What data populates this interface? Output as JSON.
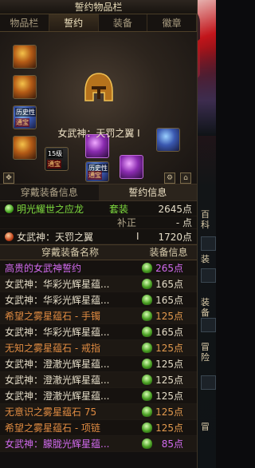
{
  "window": {
    "title": "誓约物品栏"
  },
  "tabs": [
    {
      "label": "物品栏",
      "active": false
    },
    {
      "label": "誓约",
      "active": true
    },
    {
      "label": "装备",
      "active": false
    },
    {
      "label": "徽章",
      "active": false
    }
  ],
  "equip": {
    "title": "女武神：天罚之翼 I",
    "tags": {
      "slot_a": "历史性",
      "slot_a2": "通宝",
      "slot_b": "15级",
      "slot_b2": "通宝",
      "slot_c": "历史性",
      "slot_c2": "通宝"
    }
  },
  "subtabs": [
    {
      "label": "穿戴装备信息",
      "active": false
    },
    {
      "label": "誓约信息",
      "active": true
    }
  ],
  "set_info": {
    "set_name": "明光耀世之应龙",
    "set_type": "套装",
    "set_points": "2645点",
    "bonus_label": "补正",
    "bonus_value": "- 点",
    "item_name": "女武神：天罚之翼",
    "item_level": "I",
    "item_points": "1720点"
  },
  "list": {
    "col_name": "穿戴装备名称",
    "col_info": "装备信息",
    "rows": [
      {
        "name": "高贵的女武神誓约",
        "points": "265点",
        "color": "purple"
      },
      {
        "name": "女武神：华彩光辉星蕴...",
        "points": "165点",
        "color": "white"
      },
      {
        "name": "女武神：华彩光辉星蕴...",
        "points": "165点",
        "color": "white"
      },
      {
        "name": "希望之雾星蕴石 - 手镯",
        "points": "125点",
        "color": "orange"
      },
      {
        "name": "女武神：华彩光辉星蕴...",
        "points": "165点",
        "color": "white"
      },
      {
        "name": "无知之雾星蕴石 - 戒指",
        "points": "125点",
        "color": "orange"
      },
      {
        "name": "女武神：澄澈光辉星蕴...",
        "points": "125点",
        "color": "white"
      },
      {
        "name": "女武神：澄澈光辉星蕴...",
        "points": "125点",
        "color": "white"
      },
      {
        "name": "女武神：澄澈光辉星蕴...",
        "points": "125点",
        "color": "white"
      },
      {
        "name": "无意识之雾星蕴石 75",
        "points": "125点",
        "color": "orange"
      },
      {
        "name": "希望之雾星蕴石 - 项链",
        "points": "125点",
        "color": "orange"
      },
      {
        "name": "女武神：朦胧光辉星蕴...",
        "points": "85点",
        "color": "purple"
      }
    ]
  },
  "side": {
    "label1": "百科",
    "label2": "装",
    "label3": "装备",
    "label4": "冒险",
    "label5": "冒"
  }
}
